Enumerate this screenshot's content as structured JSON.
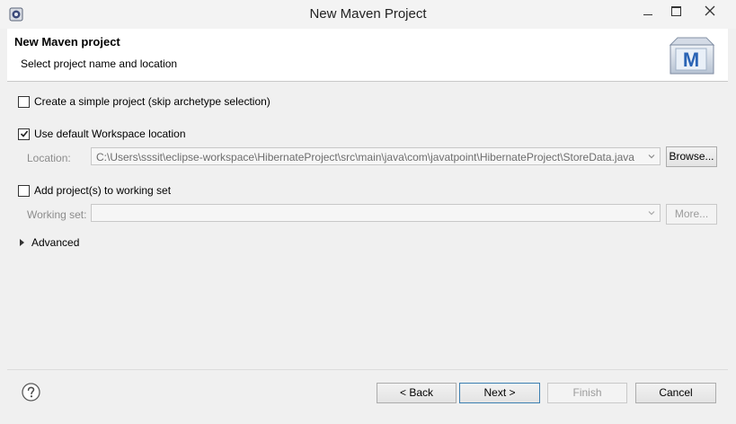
{
  "window": {
    "title": "New Maven Project",
    "minimize_icon": "minimize-icon",
    "maximize_icon": "maximize-icon",
    "close_icon": "close-icon"
  },
  "banner": {
    "title": "New Maven project",
    "subtitle": "Select project name and location",
    "logo_letter": "M"
  },
  "options": {
    "simple_project": {
      "label": "Create a simple project (skip archetype selection)",
      "checked": false
    },
    "default_workspace": {
      "label": "Use default Workspace location",
      "checked": true
    },
    "location_label": "Location:",
    "location_value": "C:\\Users\\sssit\\eclipse-workspace\\HibernateProject\\src\\main\\java\\com\\javatpoint\\HibernateProject\\StoreData.java",
    "browse_label": "Browse...",
    "working_set": {
      "label": "Add project(s) to working set",
      "checked": false
    },
    "working_set_label": "Working set:",
    "working_set_value": "",
    "more_label": "More...",
    "advanced_label": "Advanced"
  },
  "footer": {
    "back_label": "< Back",
    "next_label": "Next >",
    "finish_label": "Finish",
    "cancel_label": "Cancel"
  },
  "colors": {
    "accent": "#3c7fb1",
    "disabled_text": "#8c8c8c"
  }
}
